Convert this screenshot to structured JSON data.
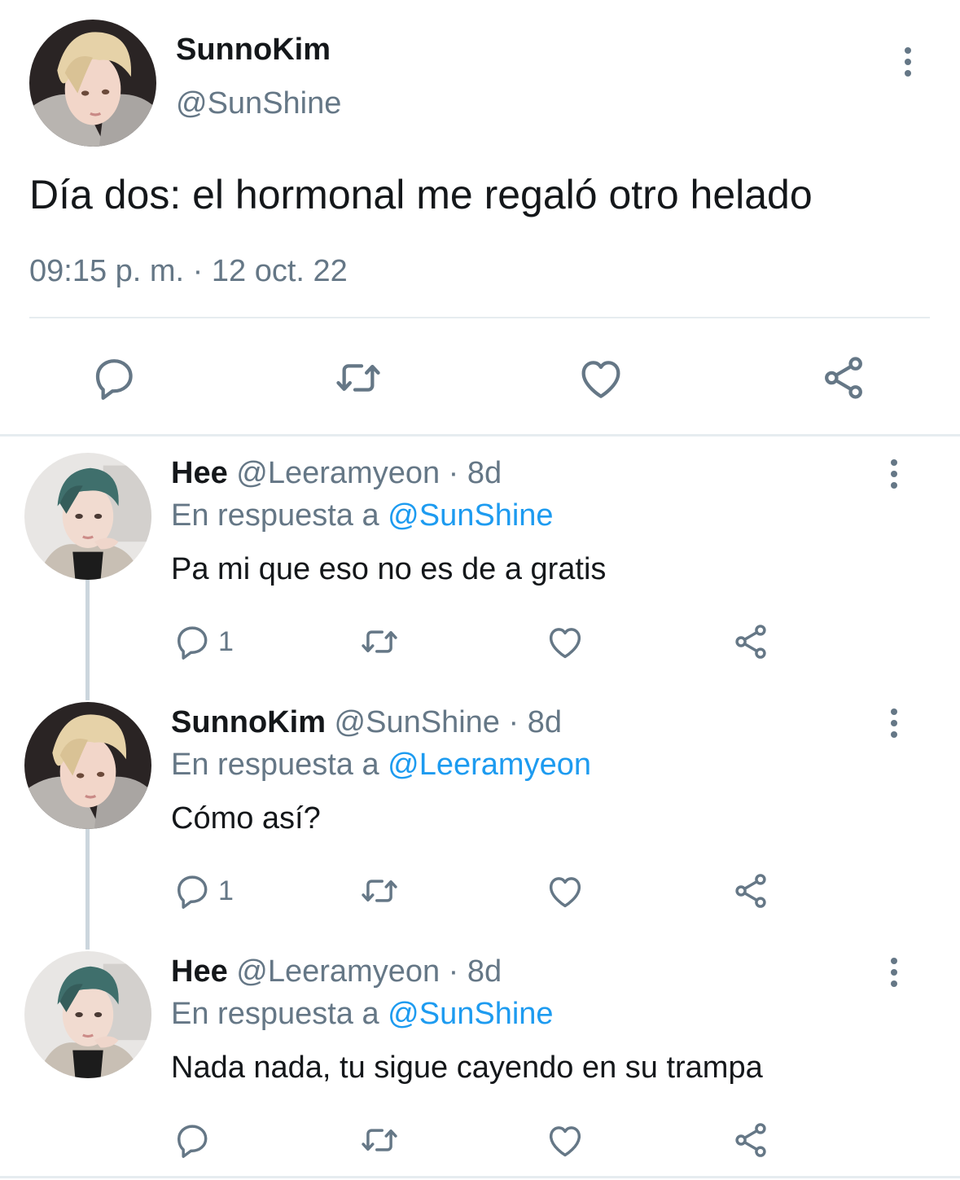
{
  "main_tweet": {
    "display_name": "SunnoKim",
    "handle": "@SunShine",
    "text": "Día dos: el hormonal me regaló otro helado",
    "timestamp": "09:15 p. m. · 12 oct. 22",
    "actions": [
      "reply-icon",
      "retweet-icon",
      "like-icon",
      "share-icon"
    ]
  },
  "replies": [
    {
      "display_name": "Hee",
      "meta": " @Leeramyeon · 8d",
      "reply_prefix": "En respuesta a ",
      "reply_to": "@SunShine",
      "text": "Pa mi que eso no es de a gratis",
      "reply_count": "1"
    },
    {
      "display_name": "SunnoKim",
      "meta": " @SunShine · 8d",
      "reply_prefix": "En respuesta a ",
      "reply_to": "@Leeramyeon",
      "text": "Cómo así?",
      "reply_count": "1"
    },
    {
      "display_name": "Hee",
      "meta": " @Leeramyeon · 8d",
      "reply_prefix": "En respuesta a ",
      "reply_to": "@SunShine",
      "text": "Nada nada, tu sigue cayendo en su trampa",
      "reply_count": ""
    }
  ],
  "colors": {
    "text": "#14171a",
    "secondary": "#657786",
    "link": "#1d9bf0",
    "divider": "#e6ecf0",
    "thread_line": "#ccd6dd"
  }
}
